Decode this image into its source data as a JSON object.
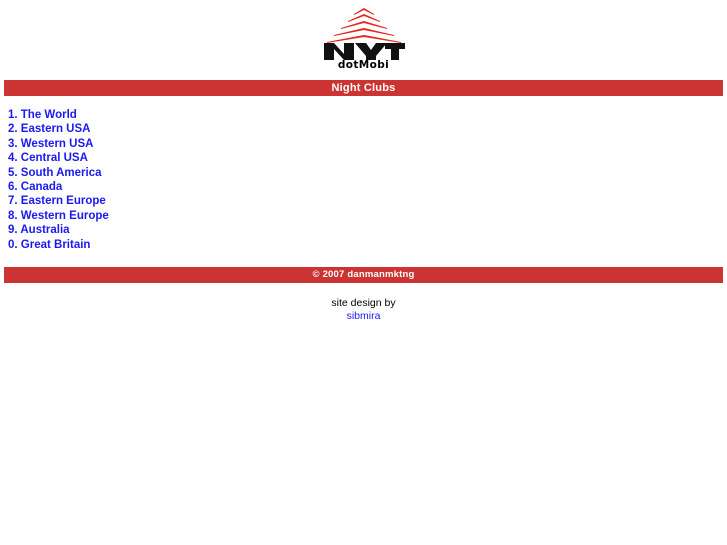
{
  "brand": {
    "logo_icon": "nyt-pyramid-logo-icon",
    "wordmark": "NYT",
    "subtitle": "dotMobi",
    "accent_color": "#cc3333"
  },
  "header": {
    "title": "Night Clubs",
    "bar_color": "#cc3333",
    "text_color": "#ffffff"
  },
  "nav": {
    "link_color": "#1a1aee",
    "items": [
      {
        "label": "1. The World"
      },
      {
        "label": "2. Eastern USA"
      },
      {
        "label": "3. Western USA"
      },
      {
        "label": "4. Central USA"
      },
      {
        "label": "5. South America"
      },
      {
        "label": "6. Canada"
      },
      {
        "label": "7. Eastern Europe"
      },
      {
        "label": "8. Western Europe"
      },
      {
        "label": "9. Australia"
      },
      {
        "label": "0. Great Britain"
      }
    ]
  },
  "footer": {
    "copyright": "© 2007 danmanmktng",
    "bar_color": "#cc3333",
    "credit_text": "site design by",
    "credit_link": "sibmira"
  }
}
